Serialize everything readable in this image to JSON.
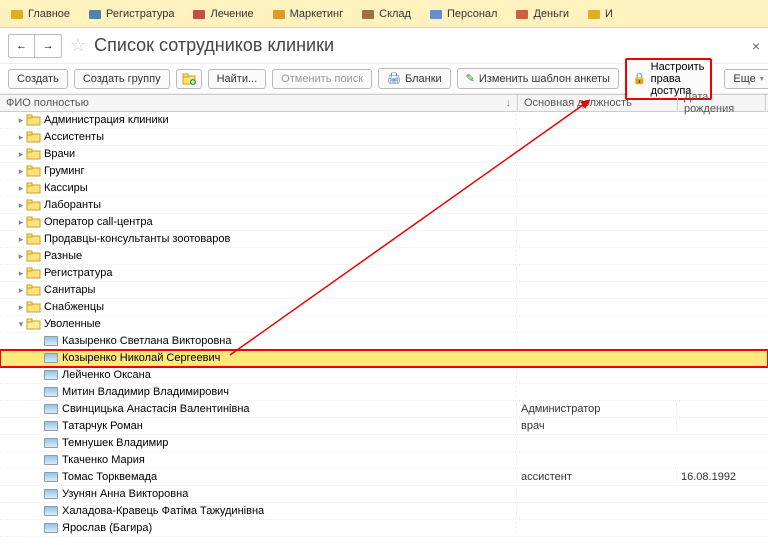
{
  "topnav": [
    {
      "label": "Главное",
      "icon": "#d9a400"
    },
    {
      "label": "Регистратура",
      "icon": "#2e6fb3"
    },
    {
      "label": "Лечение",
      "icon": "#b33"
    },
    {
      "label": "Маркетинг",
      "icon": "#d98b0a"
    },
    {
      "label": "Склад",
      "icon": "#8a5c2e"
    },
    {
      "label": "Персонал",
      "icon": "#4a7bd1"
    },
    {
      "label": "Деньги",
      "icon": "#c5432b"
    },
    {
      "label": "И",
      "icon": "#d9a400"
    }
  ],
  "header": {
    "title": "Список сотрудников клиники"
  },
  "toolbar": {
    "create": "Создать",
    "create_group": "Создать группу",
    "find": "Найти...",
    "cancel_search": "Отменить поиск",
    "blanks": "Бланки",
    "edit_template": "Изменить шаблон анкеты",
    "access_rights": "Настроить права доступа",
    "more": "Еще"
  },
  "columns": {
    "c1": "ФИО полностью",
    "c2": "Основная должность",
    "c3": "Дата рождения"
  },
  "folders": [
    {
      "label": "Администрация клиники"
    },
    {
      "label": "Ассистенты"
    },
    {
      "label": "Врачи"
    },
    {
      "label": "Груминг"
    },
    {
      "label": "Кассиры"
    },
    {
      "label": "Лаборанты"
    },
    {
      "label": "Оператор call-центра"
    },
    {
      "label": "Продавцы-консультанты зоотоваров"
    },
    {
      "label": "Разные"
    },
    {
      "label": "Регистратура"
    },
    {
      "label": "Санитары"
    },
    {
      "label": "Снабженцы"
    },
    {
      "label": "Уволенные",
      "open": true
    }
  ],
  "people": [
    {
      "name": "Казыренко Светлана Викторовна",
      "pos": "",
      "dob": ""
    },
    {
      "name": "Козыренко Николай Сергеевич",
      "pos": "",
      "dob": "",
      "selected": true
    },
    {
      "name": "Лейченко Оксана",
      "pos": "",
      "dob": ""
    },
    {
      "name": "Митин Владимир Владимирович",
      "pos": "",
      "dob": ""
    },
    {
      "name": "Свинцицька Анастасія Валентинівна",
      "pos": "Администратор",
      "dob": ""
    },
    {
      "name": "Татарчук Роман",
      "pos": "врач",
      "dob": ""
    },
    {
      "name": "Темнушек Владимир",
      "pos": "",
      "dob": ""
    },
    {
      "name": "Ткаченко Мария",
      "pos": "",
      "dob": ""
    },
    {
      "name": "Томас Торквемада",
      "pos": "ассистент",
      "dob": "16.08.1992"
    },
    {
      "name": "Узунян Анна Викторовна",
      "pos": "",
      "dob": ""
    },
    {
      "name": "Халадова-Кравець Фатіма Тажудинівна",
      "pos": "",
      "dob": ""
    },
    {
      "name": "Ярослав (Багира)",
      "pos": "",
      "dob": ""
    }
  ]
}
